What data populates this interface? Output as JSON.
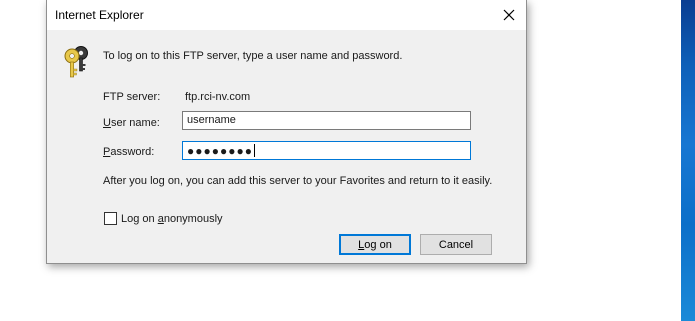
{
  "window": {
    "title": "Internet Explorer"
  },
  "dialog": {
    "intro_text": "To log on to this FTP server, type a user name and password.",
    "server_label": "FTP server:",
    "server_value": "ftp.rci-nv.com",
    "username_label_ul": "U",
    "username_label_rest": "ser name:",
    "username_value": "username",
    "password_label_ul": "P",
    "password_label_rest": "assword:",
    "password_value": "●●●●●●●●",
    "info_text": "After you log on, you can add this server to your Favorites and return to it easily.",
    "anon_label_pre": "Log on ",
    "anon_label_ul": "a",
    "anon_label_post": "nonymously",
    "anon_checked": false,
    "logon_label_ul": "L",
    "logon_label_rest": "og on",
    "cancel_label": "Cancel"
  },
  "icons": {
    "close": "close-icon",
    "keys": "keys-icon"
  },
  "colors": {
    "focus_border": "#0078d7",
    "dialog_bg": "#f0f0f0"
  }
}
